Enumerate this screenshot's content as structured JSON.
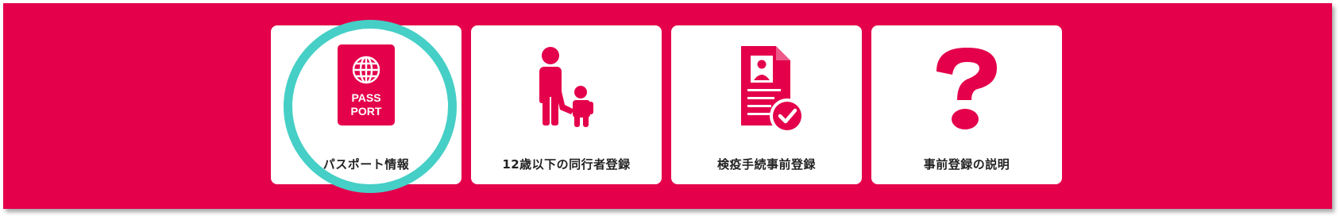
{
  "colors": {
    "background": "#E4004B",
    "card": "#FFFFFF",
    "icon": "#E4004B",
    "highlight": "#45CFC6",
    "label": "#222222"
  },
  "cards": [
    {
      "label": "パスポート情報",
      "icon": "passport-icon",
      "icon_text_line1": "PASS",
      "icon_text_line2": "PORT",
      "highlighted": true
    },
    {
      "label": "12歳以下の同行者登録",
      "icon": "adult-child-icon",
      "highlighted": false
    },
    {
      "label": "検疫手続事前登録",
      "icon": "document-check-icon",
      "highlighted": false
    },
    {
      "label": "事前登録の説明",
      "icon": "question-mark-icon",
      "highlighted": false
    }
  ]
}
